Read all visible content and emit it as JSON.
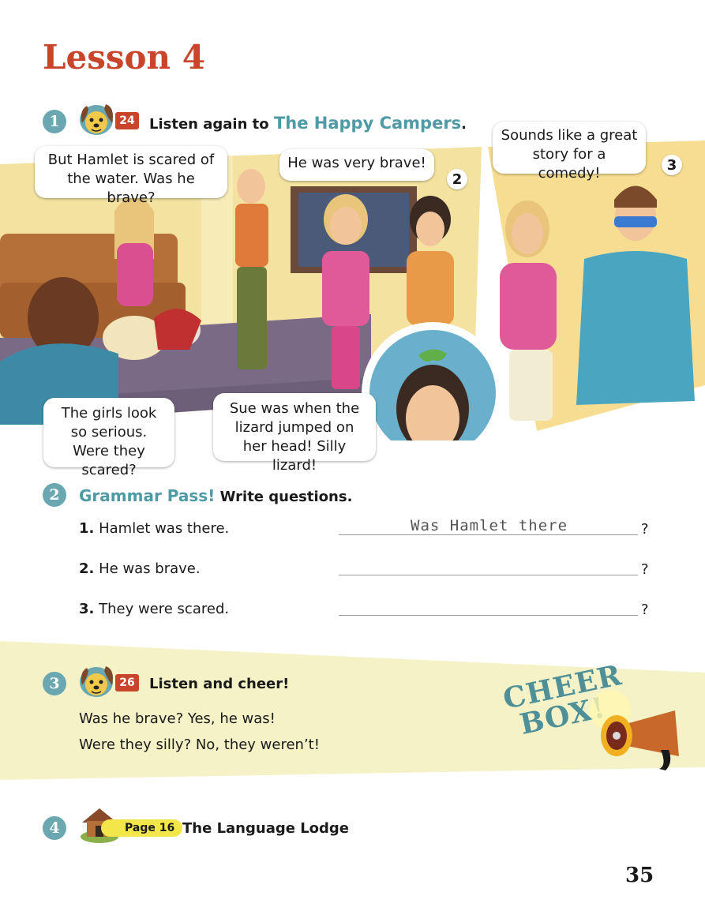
{
  "lesson_title": "Lesson 4",
  "activity1": {
    "number": "1",
    "track": "24",
    "instruction": "Listen again to",
    "story_title": "The Happy Campers",
    "title_end": "."
  },
  "comic": {
    "panel2_number": "2",
    "panel3_number": "3",
    "bubbles": {
      "hamlet_scared": "But Hamlet is scared of the water. Was he brave?",
      "very_brave": "He was very brave!",
      "great_story": "Sounds like a great story for a comedy!",
      "girls_serious": "The girls look so serious. Were they scared?",
      "sue_lizard": "Sue was when the lizard jumped on her head! Silly lizard!"
    }
  },
  "activity2": {
    "number": "2",
    "title": "Grammar Pass!",
    "instruction": "Write questions.",
    "items": [
      {
        "num": "1.",
        "text": "Hamlet was there.",
        "answer": "Was Hamlet there",
        "end": "?"
      },
      {
        "num": "2.",
        "text": "He was brave.",
        "answer": "",
        "end": "?"
      },
      {
        "num": "3.",
        "text": "They were scared.",
        "answer": "",
        "end": "?"
      }
    ]
  },
  "activity3": {
    "number": "3",
    "track": "26",
    "instruction": "Listen and cheer!",
    "lines": [
      "Was he brave? Yes, he was!",
      "Were they silly? No, they weren’t!"
    ],
    "cheer_box_line1": "CHEER",
    "cheer_box_line2": "BOX!"
  },
  "activity4": {
    "number": "4",
    "page_ref": "Page 16",
    "title": "The Language Lodge"
  },
  "page_number": "35"
}
